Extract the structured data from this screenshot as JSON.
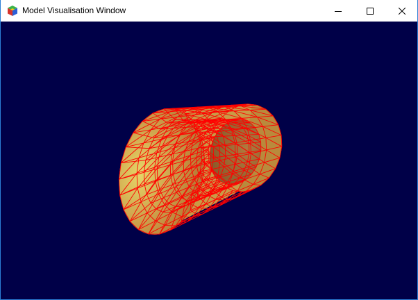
{
  "window": {
    "title": "Model Visualisation Window",
    "icon": "app-icon"
  },
  "controls": {
    "minimize_icon": "minimize-icon",
    "maximize_icon": "maximize-icon",
    "close_icon": "close-icon"
  },
  "viewport": {
    "background_color": "#000048",
    "model": "tube-mesh",
    "surface_color": "#d2b050",
    "wireframe_color": "#ff0000"
  }
}
